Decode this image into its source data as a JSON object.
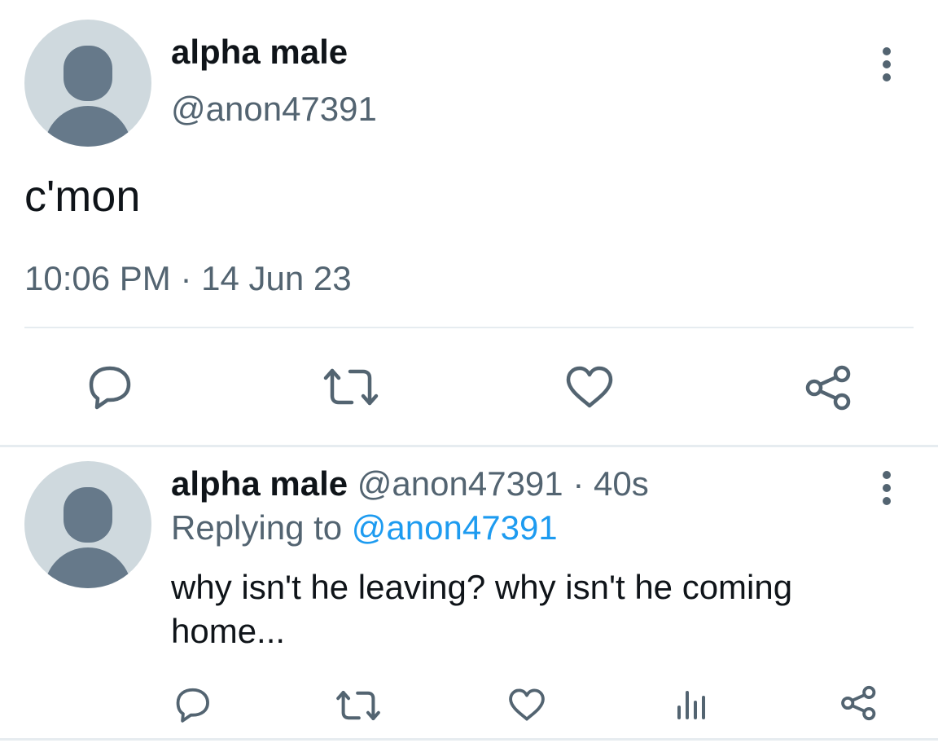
{
  "main_tweet": {
    "display_name": "alpha male",
    "handle": "@anon47391",
    "text": "c'mon",
    "timestamp": "10:06 PM · 14 Jun 23",
    "actions": [
      "reply-icon",
      "retweet-icon",
      "like-icon",
      "share-icon"
    ]
  },
  "reply_tweet": {
    "display_name": "alpha male",
    "handle": "@anon47391",
    "separator": " · ",
    "age": "40s",
    "replying_prefix": "Replying to ",
    "replying_to": "@anon47391",
    "text": "why isn't he leaving? why isn't he coming home...",
    "actions": [
      "reply-icon",
      "retweet-icon",
      "like-icon",
      "views-icon",
      "share-icon"
    ]
  },
  "colors": {
    "text_primary": "#0f1419",
    "text_secondary": "#536471",
    "link": "#1d9bf0",
    "avatar_bg": "#cfd9de",
    "avatar_fg": "#66798a",
    "divider": "#e6ecf0"
  }
}
